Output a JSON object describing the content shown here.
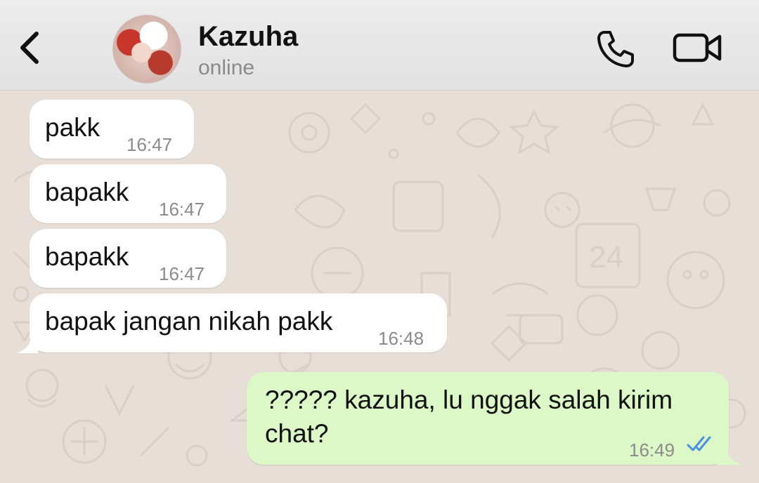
{
  "header": {
    "contact_name": "Kazuha",
    "status": "online"
  },
  "messages": [
    {
      "direction": "incoming",
      "text": "pakk",
      "time": "16:47"
    },
    {
      "direction": "incoming",
      "text": "bapakk",
      "time": "16:47"
    },
    {
      "direction": "incoming",
      "text": "bapakk",
      "time": "16:47"
    },
    {
      "direction": "incoming",
      "text": "bapak jangan nikah pakk",
      "time": "16:48"
    },
    {
      "direction": "outgoing",
      "text_line1": "????? kazuha, lu nggak salah kirim",
      "text_line2": "chat?",
      "time": "16:49",
      "status": "read"
    }
  ],
  "colors": {
    "incoming_bubble": "#ffffff",
    "outgoing_bubble": "#dcf8c6",
    "read_ticks": "#4a90e2",
    "chat_background": "#e7ded7"
  },
  "icons": [
    "back-chevron-icon",
    "phone-icon",
    "video-camera-icon",
    "double-check-icon"
  ]
}
